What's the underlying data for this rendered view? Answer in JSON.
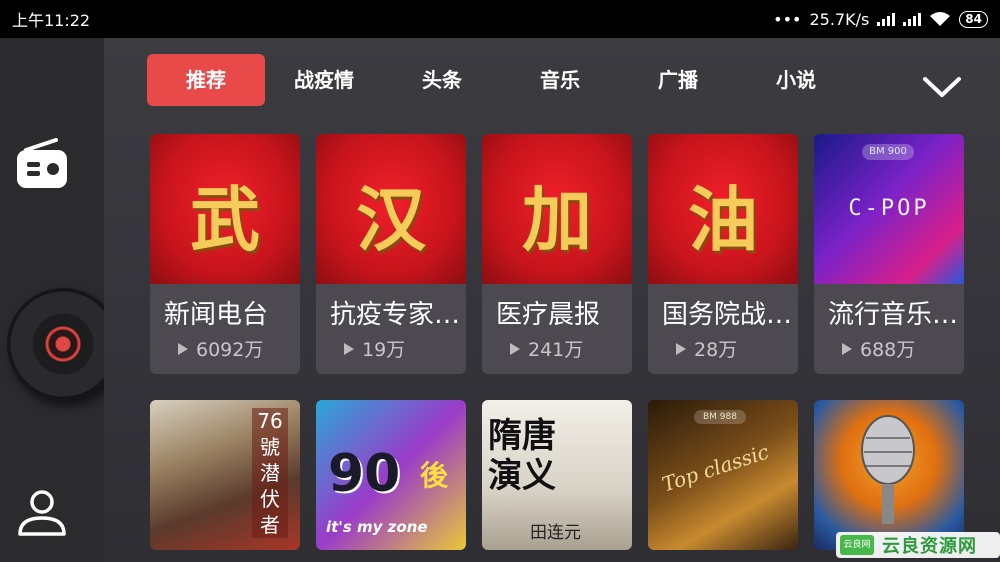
{
  "status_bar": {
    "time": "上午11:22",
    "dots": "•••",
    "net_speed": "25.7K/s",
    "battery": "84"
  },
  "sidebar": {
    "items": [
      {
        "icon": "radio-icon"
      },
      {
        "icon": "now-playing-disc"
      },
      {
        "icon": "user-icon"
      }
    ]
  },
  "tabs": [
    {
      "label": "推荐",
      "active": true
    },
    {
      "label": "战疫情",
      "active": false
    },
    {
      "label": "头条",
      "active": false
    },
    {
      "label": "音乐",
      "active": false
    },
    {
      "label": "广播",
      "active": false
    },
    {
      "label": "小说",
      "active": false
    }
  ],
  "expand_icon": "chevron-down-icon",
  "cards_row1": [
    {
      "cover_text": "武",
      "title": "新闻电台",
      "plays": "6092万"
    },
    {
      "cover_text": "汉",
      "title": "抗疫专家…",
      "plays": "19万"
    },
    {
      "cover_text": "加",
      "title": "医疗晨报",
      "plays": "241万"
    },
    {
      "cover_text": "油",
      "title": "国务院战…",
      "plays": "28万"
    },
    {
      "cover_badge": "BM 900",
      "cover_text": "C-POP",
      "title": "流行音乐…",
      "plays": "688万"
    }
  ],
  "cards_row2": [
    {
      "cover_text": "76號潜伏者"
    },
    {
      "cover_text": "90",
      "cover_text2": "後",
      "cover_text3": "it's my zone"
    },
    {
      "cover_text": "隋唐演义",
      "cover_text2": "田连元"
    },
    {
      "cover_badge": "BM 988",
      "cover_text": "Top classic"
    },
    {
      "cover_text": ""
    }
  ],
  "watermark": {
    "logo_text": "云良网",
    "text": "云良资源网"
  },
  "colors": {
    "accent": "#e84a4a",
    "background": "#3a3a3f",
    "sidebar": "#2b2b2e"
  }
}
